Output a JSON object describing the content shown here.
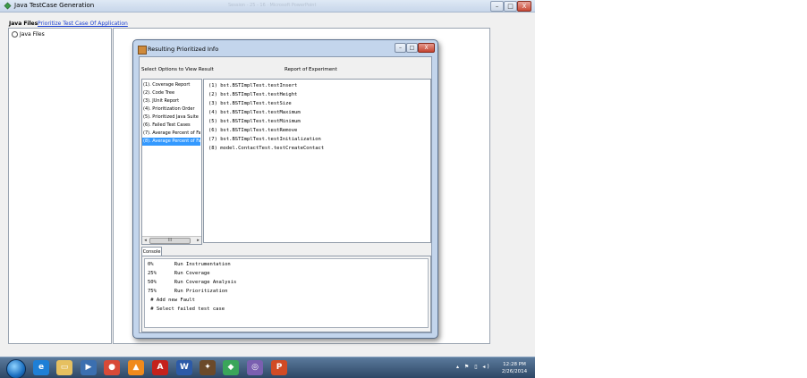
{
  "app": {
    "title": "Java TestCase Generation",
    "faded_title": "Session - 25 - 16 · Microsoft PowerPoint",
    "controls": {
      "minimize": "–",
      "maximize": "□",
      "close": "X"
    }
  },
  "tabs": {
    "java_files": "Java Files",
    "prioritize": "Prioritize Test Case Of Application"
  },
  "tree": {
    "root": "Java Files"
  },
  "dialog": {
    "title": "Resulting Prioritized Info",
    "controls": {
      "minimize": "–",
      "maximize": "□",
      "close": "X"
    },
    "options_label": "Select Options to View Result",
    "report_label": "Report of Experiment",
    "options": [
      "(1). Coverage Report",
      "(2). Code Tree",
      "(3). JUnit Report",
      "(4). Prioritization Order",
      "(5). Prioritized Java Suite",
      "(6). Failed Test Cases",
      "(7). Average Percent of Faults",
      "(8). Average Percent of Faults"
    ],
    "selected_option_index": 7,
    "scroll": {
      "left": "◂",
      "right": "▸",
      "grip": "III"
    },
    "report_lines": [
      "(1) bst.BSTImplTest.testInsert",
      "(2) bst.BSTImplTest.testHeight",
      "(3) bst.BSTImplTest.testSize",
      "(4) bst.BSTImplTest.testMaximum",
      "(5) bst.BSTImplTest.testMinimum",
      "(6) bst.BSTImplTest.testRemove",
      "(7) bst.BSTImplTest.testInitialization",
      "(8) model.ContactTest.testCreateContact"
    ],
    "console_tab": "Console",
    "console_lines": [
      "0%       Run Instrumentation",
      "25%      Run Coverage",
      "50%      Run Coverage Analysis",
      "75%      Run Prioritization",
      " # Add new Fault",
      " # Select failed test case"
    ]
  },
  "taskbar": {
    "icons": [
      "ie-icon",
      "explorer-icon",
      "media-icon",
      "chrome-icon",
      "vlc-icon",
      "acrobat-icon",
      "word-icon",
      "app-icon",
      "android-icon",
      "eclipse-icon",
      "powerpoint-icon"
    ],
    "tray": "▴ ⚑ ▯ ◂)",
    "time": "12:28 PM",
    "date": "2/26/2014"
  }
}
